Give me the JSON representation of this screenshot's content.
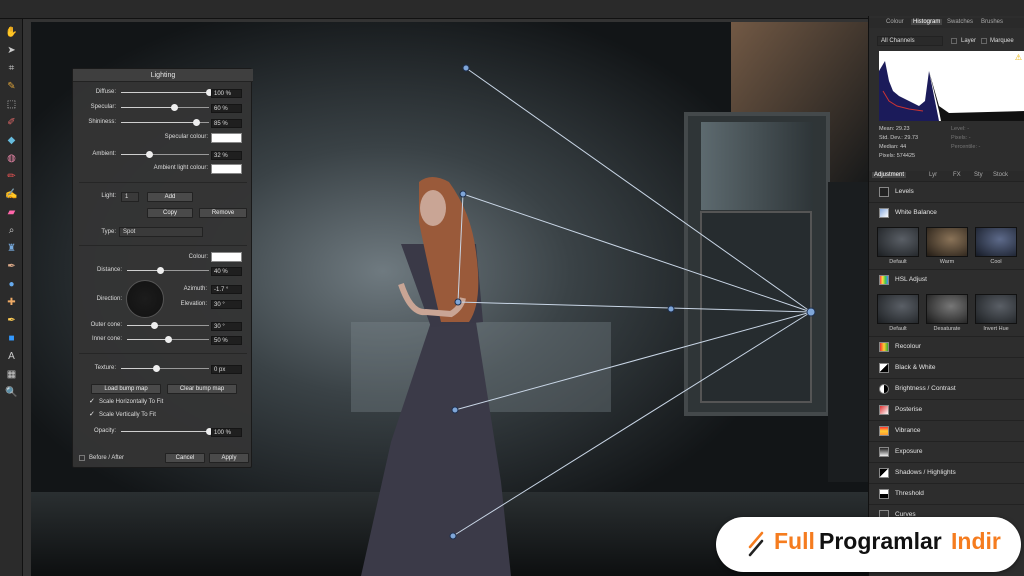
{
  "lighting": {
    "title": "Lighting",
    "diffuse": {
      "label": "Diffuse:",
      "value": "100 %",
      "level": 1.0
    },
    "specular": {
      "label": "Specular:",
      "value": "60 %",
      "level": 0.6
    },
    "shininess": {
      "label": "Shininess:",
      "value": "85 %",
      "level": 0.85
    },
    "specular_colour": "Specular colour:",
    "ambient": {
      "label": "Ambient:",
      "value": "32 %",
      "level": 0.32
    },
    "ambient_colour": "Ambient light colour:",
    "light_label": "Light:",
    "light_index": "1",
    "add": "Add",
    "copy": "Copy",
    "remove": "Remove",
    "type_label": "Type:",
    "type_value": "Spot",
    "colour": "Colour:",
    "distance": {
      "label": "Distance:",
      "value": "40 %",
      "level": 0.4
    },
    "direction": "Direction:",
    "azimuth": {
      "label": "Azimuth:",
      "value": "-1.7 °"
    },
    "elevation": {
      "label": "Elevation:",
      "value": "30 °"
    },
    "outer_cone": {
      "label": "Outer cone:",
      "value": "30 °",
      "level": 0.33
    },
    "inner_cone": {
      "label": "Inner cone:",
      "value": "50 %",
      "level": 0.5
    },
    "texture": {
      "label": "Texture:",
      "value": "0 px",
      "level": 0.4
    },
    "load_bump": "Load bump map",
    "clear_bump": "Clear bump map",
    "scale_h": "Scale Horizontally To Fit",
    "scale_v": "Scale Vertically To Fit",
    "opacity": {
      "label": "Opacity:",
      "value": "100 %",
      "level": 1.0
    },
    "before_after": "Before / After",
    "cancel": "Cancel",
    "apply": "Apply"
  },
  "studio": {
    "tabs": [
      "Colour",
      "Histogram",
      "Swatches",
      "Brushes"
    ],
    "active_tab": "Histogram",
    "channels": "All Channels",
    "layer": "Layer",
    "marquee": "Marquee",
    "stats_left": [
      "Mean: 29.23",
      "Std. Dev.: 29.73",
      "Median: 44",
      "Pixels: 574425"
    ],
    "stats_right": [
      "Level: -",
      "Pixels: -",
      "Percentile: -"
    ],
    "tabs2": [
      "Adjustment",
      "Lyr",
      "FX",
      "Sty",
      "Stock"
    ],
    "active_tab2": "Adjustment",
    "levels": "Levels",
    "white_balance": "White Balance",
    "wb_presets": [
      "Default",
      "Warm",
      "Cool"
    ],
    "hsl": "HSL Adjust",
    "hsl_presets": [
      "Default",
      "Desaturate",
      "Invert Hue"
    ],
    "adjustments": [
      "Recolour",
      "Black & White",
      "Brightness / Contrast",
      "Posterise",
      "Vibrance",
      "Exposure",
      "Shadows / Highlights",
      "Threshold",
      "Curves"
    ]
  },
  "brand": {
    "part1": "Full",
    "part2": "Programlar",
    "part3": "Indir"
  },
  "colors": {
    "accent": "#f57c1f",
    "panel": "#2d2d2d",
    "light_handle": "#7fa6d8"
  },
  "icons": [
    "hand-icon",
    "move-icon",
    "crop-icon",
    "eyedropper-icon",
    "marquee-icon",
    "selection-brush-icon",
    "flood-fill-icon",
    "color-wheel-icon",
    "paint-brush-icon",
    "smudge-icon",
    "eraser-icon",
    "zoom-icon",
    "clone-icon",
    "dodge-icon",
    "blur-icon",
    "healing-icon",
    "pen-icon",
    "rectangle-icon",
    "text-icon",
    "mesh-warp-icon",
    "magnifier-icon"
  ]
}
